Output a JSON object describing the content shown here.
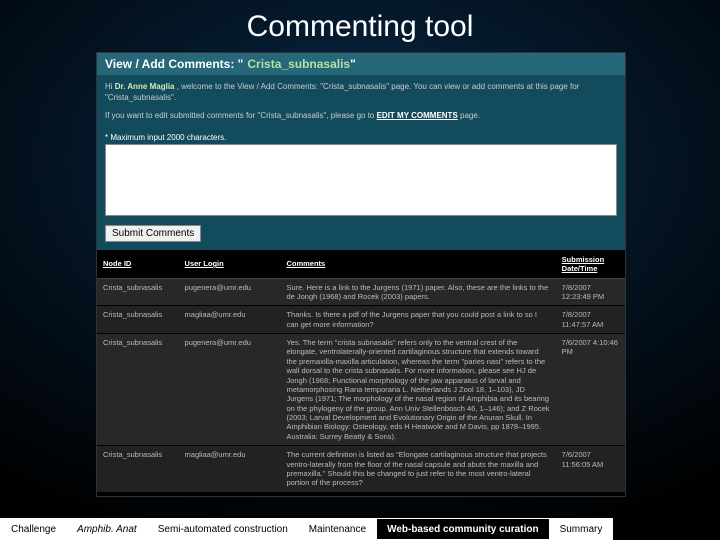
{
  "slide_title": "Commenting tool",
  "window": {
    "header_prefix": "View / Add Comments: \"",
    "topic": "Crista_subnasalis",
    "header_suffix": "\"",
    "welcome_prefix": "Hi ",
    "username": "Dr. Anne Maglia",
    "welcome_suffix": ", welcome to the View / Add Comments: \"Crista_subnasalis\" page. You can view or add comments at this page for \"Crista_subnasalis\".",
    "edit_note_prefix": "If you want to edit submitted comments for \"Crista_subnasalis\", please go to ",
    "edit_link_text": "EDIT MY COMMENTS",
    "edit_note_suffix": " page.",
    "max_note": "* Maximum input 2000 characters.",
    "submit_label": "Submit Comments",
    "textarea_placeholder": ""
  },
  "table": {
    "headers": {
      "node": "Node ID",
      "user": "User Login",
      "comments": "Comments",
      "date": "Submission Date/Time"
    },
    "rows": [
      {
        "node": "Crista_subnasalis",
        "user": "pugenera@umr.edu",
        "comment": "Sure. Here is a link to the Jurgens (1971) paper. Also, these are the links to the de Jongh (1968) and Rocek (2003) papers.",
        "date": "7/8/2007 12:23:49 PM"
      },
      {
        "node": "Crista_subnasalis",
        "user": "magliaa@umr.edu",
        "comment": "Thanks. Is there a pdf of the Jurgens paper that you could post a link to so I can get more information?",
        "date": "7/8/2007 11:47:57 AM"
      },
      {
        "node": "Crista_subnasalis",
        "user": "pugenera@umr.edu",
        "comment": "Yes. The term \"crista subnasalis\" refers only to the ventral crest of the elongate, ventrolaterally-oriented cartilaginous structure that extends toward the premaxilla-maxilla articulation, whereas the term \"paries nasi\" refers to the wall dorsal to the crista subnasalis. For more information, please see HJ de Jongh (1968; Functional morphology of the jaw apparatus of larval and metamorphosing Rana temporaria L. Netherlands J Zool 18, 1–103), JD Jurgens (1971; The morphology of the nasal region of Amphibia and its bearing on the phylogeny of the group. Ann Univ Stellenbosch 46, 1–146); and Z Rocek (2003; Larval Development and Evolutionary Origin of the Anuran Skull. In Amphibian Biology: Osteology, eds H Heatwole and M Davis, pp 1878–1995. Australia: Surrey Beatty & Sons).",
        "date": "7/6/2007 4:10:46 PM"
      },
      {
        "node": "Crista_subnasalis",
        "user": "magliaa@umr.edu",
        "comment": "The current definition is listed as \"Elongate cartilaginous structure that projects ventro-laterally from the floor of the nasal capsule and abuts the maxilla and premaxilla.\" Should this be changed to just refer to the most ventro-lateral portion of the process?",
        "date": "7/6/2007 11:56:05 AM"
      }
    ]
  },
  "nav": {
    "items": [
      {
        "label": "Challenge",
        "active": false,
        "italic": false
      },
      {
        "label": "Amphib. Anat",
        "active": false,
        "italic": true
      },
      {
        "label": "Semi-automated construction",
        "active": false,
        "italic": false
      },
      {
        "label": "Maintenance",
        "active": false,
        "italic": false
      },
      {
        "label": "Web-based community curation",
        "active": true,
        "italic": false
      },
      {
        "label": "Summary",
        "active": false,
        "italic": false
      }
    ]
  }
}
